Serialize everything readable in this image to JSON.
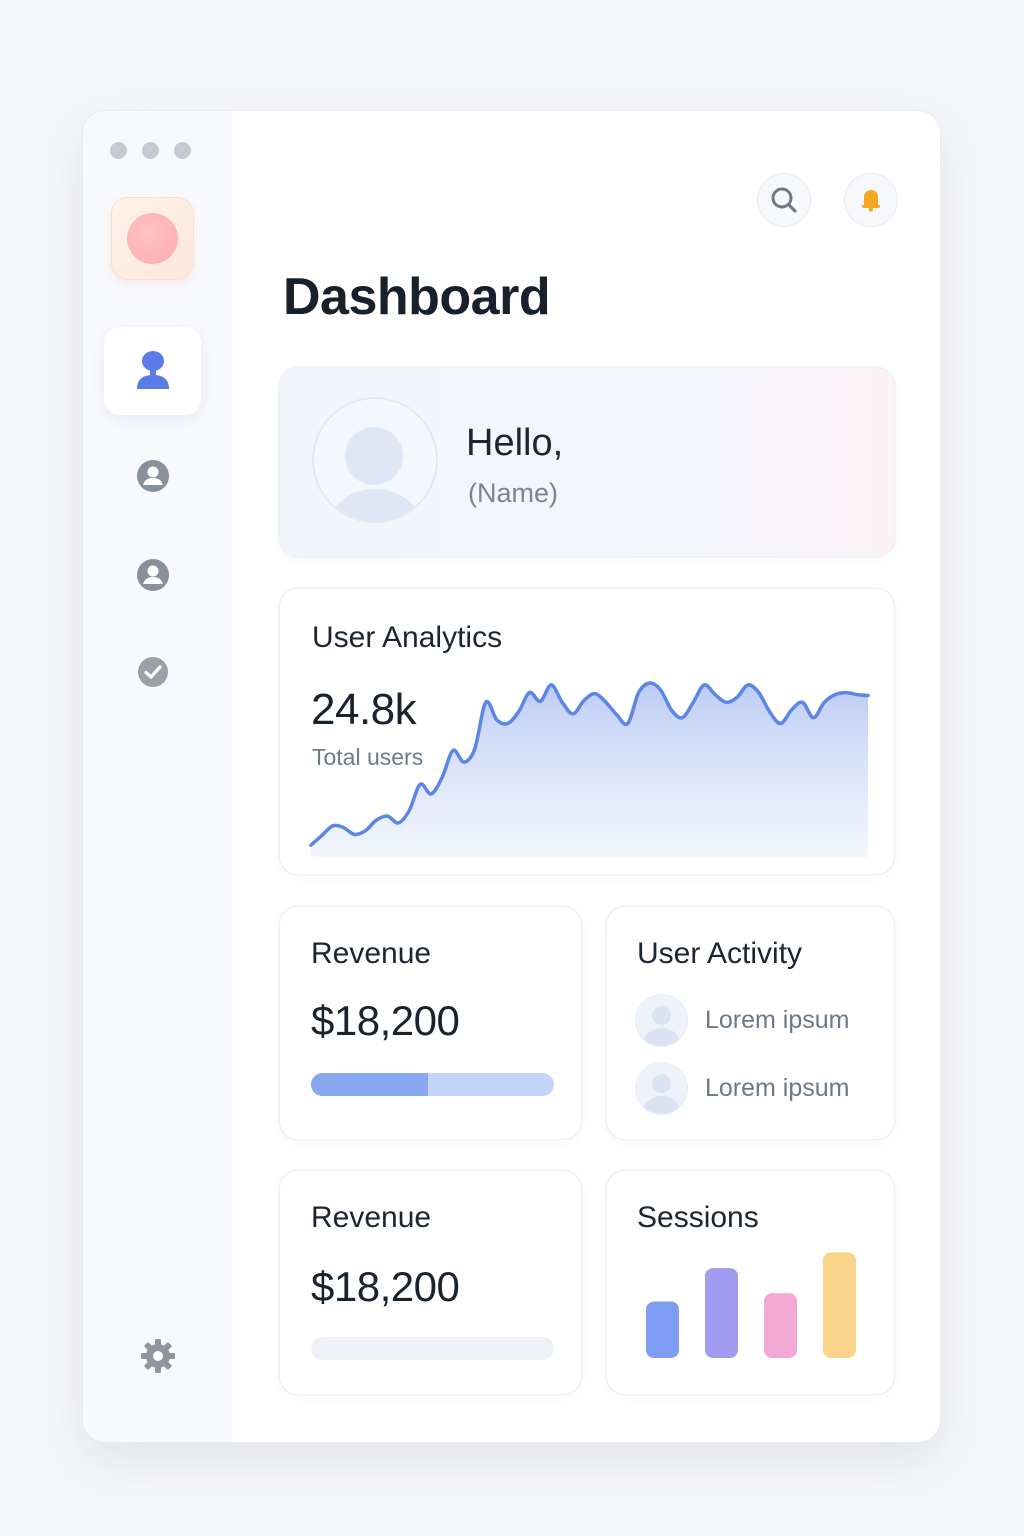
{
  "window": {
    "traffic_lights": [
      "#c6cbd2",
      "#c6cbd2",
      "#c6cbd2"
    ]
  },
  "sidebar": {
    "logo_icon": "app-logo-icon",
    "items": [
      {
        "icon": "user-profile-icon",
        "active": true,
        "color": "#5b7be6"
      },
      {
        "icon": "account-circle-icon",
        "active": false,
        "color": "#8a9099"
      },
      {
        "icon": "account-circle-icon",
        "active": false,
        "color": "#8a9099"
      },
      {
        "icon": "check-circle-icon",
        "active": false,
        "color": "#9aa0a8"
      }
    ],
    "settings_icon": "gear-icon"
  },
  "header": {
    "search_icon": "search-icon",
    "notification_icon": "bell-icon",
    "notification_color": "#f5a623"
  },
  "page": {
    "title": "Dashboard"
  },
  "greeting": {
    "hello": "Hello,",
    "name": "(Name)"
  },
  "analytics": {
    "title": "User Analytics",
    "value": "24.8k",
    "label": "Total users",
    "line_color": "#5b86e8"
  },
  "chart_data": [
    {
      "type": "area",
      "title": "User Analytics",
      "x": [
        0,
        1,
        2,
        3,
        4,
        5,
        6,
        7,
        8,
        9,
        10,
        11,
        12,
        13,
        14,
        15,
        16,
        17,
        18,
        19,
        20,
        21,
        22,
        23,
        24,
        25,
        26,
        27,
        28,
        29,
        30,
        31,
        32,
        33,
        34,
        35,
        36,
        37,
        38,
        39,
        40,
        41,
        42,
        43,
        44,
        45,
        46,
        47,
        48,
        49,
        50,
        51
      ],
      "values": [
        2,
        12,
        22,
        20,
        13,
        17,
        28,
        32,
        25,
        38,
        65,
        55,
        72,
        100,
        88,
        102,
        150,
        132,
        128,
        140,
        160,
        151,
        168,
        150,
        138,
        152,
        159,
        150,
        137,
        128,
        160,
        170,
        163,
        142,
        134,
        150,
        168,
        158,
        150,
        155,
        168,
        160,
        140,
        128,
        142,
        150,
        134,
        150,
        158,
        160,
        158,
        157
      ],
      "ylim": [
        0,
        170
      ],
      "grid": false
    },
    {
      "type": "bar",
      "title": "Sessions",
      "categories": [
        "1",
        "2",
        "3",
        "4"
      ],
      "values": [
        54,
        86,
        62,
        101
      ],
      "colors": [
        "#7f9cf5",
        "#a19cf2",
        "#f3a9d6",
        "#fad48a"
      ],
      "ylim": [
        0,
        110
      ]
    }
  ],
  "revenue_primary": {
    "title": "Revenue",
    "value": "$18,200",
    "progress": 0.48,
    "fill_color": "#8aa8f0",
    "track_color": "#c5d4fa"
  },
  "user_activity": {
    "title": "User Activity",
    "items": [
      {
        "label": "Lorem ipsum"
      },
      {
        "label": "Lorem ipsum"
      }
    ]
  },
  "revenue_secondary": {
    "title": "Revenue",
    "value": "$18,200",
    "progress": 0,
    "track_color": "#eef1f5"
  },
  "sessions": {
    "title": "Sessions"
  }
}
